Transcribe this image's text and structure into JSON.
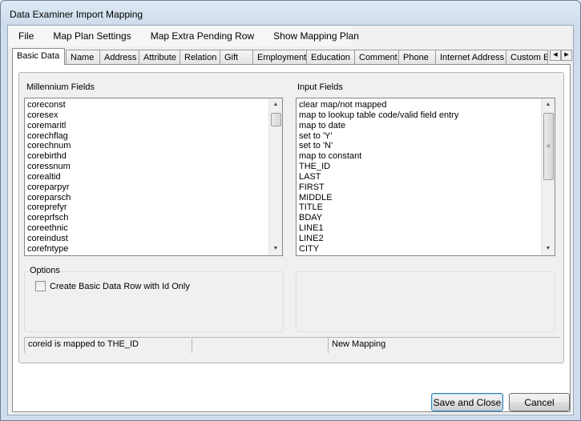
{
  "window": {
    "title": "Data Examiner Import Mapping"
  },
  "menu": {
    "items": [
      "File",
      "Map Plan Settings",
      "Map Extra Pending Row",
      "Show Mapping Plan"
    ]
  },
  "tabs": [
    "Basic Data",
    "Name",
    "Address",
    "Attribute",
    "Relation",
    "Gift",
    "Employment",
    "Education",
    "Comment",
    "Phone",
    "Internet Address",
    "Custom E"
  ],
  "active_tab": "Basic Data",
  "millennium_fields": {
    "label": "Millennium Fields",
    "items": [
      "coreconst",
      "coresex",
      "coremaritl",
      "corechflag",
      "corechnum",
      "corebirthd",
      "coressnum",
      "corealtid",
      "coreparpyr",
      "coreparsch",
      "coreprefyr",
      "coreprfsch",
      "coreethnic",
      "coreindust",
      "corefntype"
    ]
  },
  "input_fields": {
    "label": "Input Fields",
    "items": [
      "clear map/not mapped",
      "map to lookup table code/valid field entry",
      "map to date",
      "set to 'Y'",
      "set to 'N'",
      "map to constant",
      "THE_ID",
      "LAST",
      "FIRST",
      "MIDDLE",
      "TITLE",
      "BDAY",
      "LINE1",
      "LINE2",
      "CITY"
    ]
  },
  "options": {
    "label": "Options",
    "checkbox_label": "Create Basic Data Row with Id Only",
    "checked": false
  },
  "status": {
    "mapping_text": "coreid is mapped to THE_ID",
    "middle_text": "",
    "mode_text": "New Mapping"
  },
  "buttons": {
    "save_close": "Save and Close",
    "cancel": "Cancel"
  }
}
